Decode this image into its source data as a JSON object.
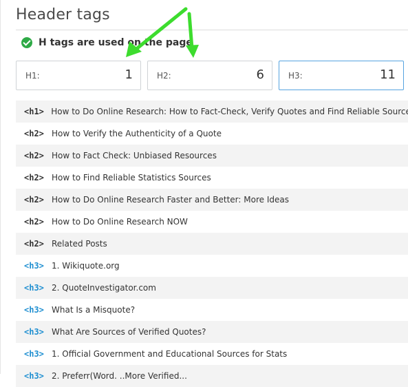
{
  "section": {
    "title": "Header tags",
    "status_text": "H tags are used on the page",
    "status_icon": "check-circle-icon",
    "status_color": "#2eaa46"
  },
  "counts": [
    {
      "label": "H1:",
      "value": "1"
    },
    {
      "label": "H2:",
      "value": "6"
    },
    {
      "label": "H3:",
      "value": "11"
    }
  ],
  "headings": [
    {
      "tag": "<h1>",
      "text": "How to Do Online Research: How to Fact-Check, Verify Quotes and Find Reliable Sources"
    },
    {
      "tag": "<h2>",
      "text": "How to Verify the Authenticity of a Quote"
    },
    {
      "tag": "<h2>",
      "text": "How to Fact Check: Unbiased Resources"
    },
    {
      "tag": "<h2>",
      "text": "How to Find Reliable Statistics Sources"
    },
    {
      "tag": "<h2>",
      "text": "How to Do Online Research Faster and Better: More Ideas"
    },
    {
      "tag": "<h2>",
      "text": "How to Do Online Research NOW"
    },
    {
      "tag": "<h2>",
      "text": "Related Posts"
    },
    {
      "tag": "<h3>",
      "text": "1. Wikiquote.org"
    },
    {
      "tag": "<h3>",
      "text": "2. QuoteInvestigator.com"
    },
    {
      "tag": "<h3>",
      "text": "What Is a Misquote?"
    },
    {
      "tag": "<h3>",
      "text": "What Are Sources of Verified Quotes?"
    },
    {
      "tag": "<h3>",
      "text": "1. Official Government and Educational Sources for Stats"
    },
    {
      "tag": "<h3>",
      "text": "2. Preferr(Word. ..More Verified..."
    }
  ],
  "colors": {
    "h3_tag": "#1f8fd1",
    "active_border": "#55a3e0",
    "annotation_arrow": "#3ddc2e"
  }
}
